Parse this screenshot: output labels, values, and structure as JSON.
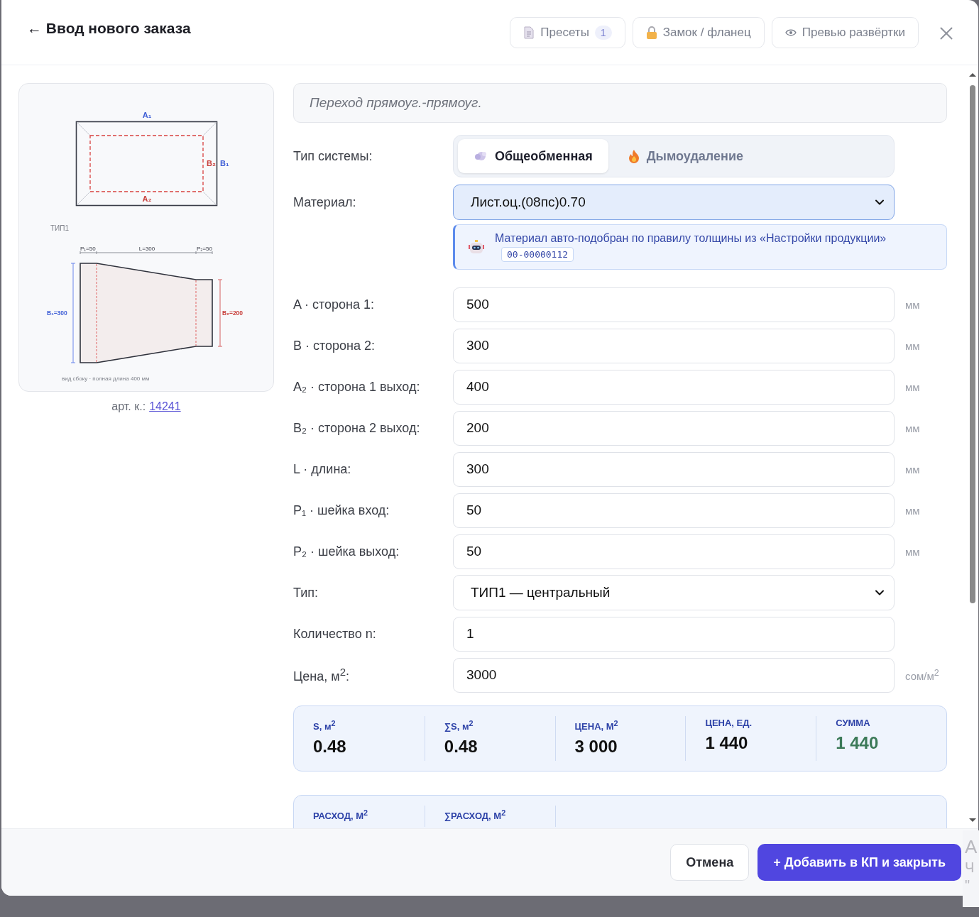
{
  "header": {
    "title": "← Ввод нового заказа",
    "buttons": [
      {
        "kind": "presets",
        "label": "Пресеты",
        "badge": "1"
      },
      {
        "kind": "lock",
        "label": "Замок / фланец"
      },
      {
        "kind": "eye",
        "label": "Превью развёртки"
      }
    ]
  },
  "diagram": {
    "top_labels": [
      "A₁",
      "B₂",
      "B₁",
      "A₂"
    ],
    "type_label": "ТИП1",
    "side_labels": [
      "P₁=50",
      "L=300",
      "P₂=50",
      "B₁=300",
      "B₂=200"
    ],
    "caption": "вид сбоку · полная длина 400 мм"
  },
  "article": {
    "label": "арт. к.:",
    "link": "14241"
  },
  "product_name": "Переход прямоуг.-прямоуг.",
  "system_type": {
    "label": "Тип системы:",
    "options": [
      {
        "kind": "air",
        "label": "Общеобменная",
        "selected": true
      },
      {
        "kind": "fire",
        "label": "Дымоудаление",
        "selected": false
      }
    ]
  },
  "material": {
    "label": "Материал:",
    "value": "Лист.оц.(08пс)0.70",
    "focused": true
  },
  "notice": {
    "text": "Материал авто-подобран по правилу толщины из «Настройки продукции»",
    "code": "00-00000112"
  },
  "fields": [
    {
      "kind": "input",
      "label": "A · сторона 1:",
      "value": "500",
      "unit": "мм"
    },
    {
      "kind": "input",
      "label": "B · сторона 2:",
      "value": "300",
      "unit": "мм"
    },
    {
      "kind": "input",
      "label": "A₂ · сторона 1 выход:",
      "value": "400",
      "unit": "мм"
    },
    {
      "kind": "input",
      "label": "B₂ · сторона 2 выход:",
      "value": "200",
      "unit": "мм"
    },
    {
      "kind": "input",
      "label": "L · длина:",
      "value": "300",
      "unit": "мм"
    },
    {
      "kind": "input",
      "label": "P₁ · шейка вход:",
      "value": "50",
      "unit": "мм"
    },
    {
      "kind": "input",
      "label": "P₂ · шейка выход:",
      "value": "50",
      "unit": "мм"
    },
    {
      "kind": "select",
      "label": "Тип:",
      "value": "ТИП1 — центральный"
    },
    {
      "kind": "input",
      "label": "Количество n:",
      "value": "1"
    },
    {
      "kind": "input",
      "label": "Цена, м$^{2}$:",
      "value": "3000",
      "unit": "сом/м$^{2}$"
    }
  ],
  "summary": [
    {
      "label": "S, м$^{2}$",
      "value": "0.48",
      "highlight": false
    },
    {
      "label": "∑S, м$^{2}$",
      "value": "0.48",
      "highlight": false
    },
    {
      "label": "ЦЕНА, М$^{2}$",
      "value": "3 000",
      "highlight": false
    },
    {
      "label": "ЦЕНА, ЕД.",
      "value": "1 440",
      "highlight": false
    },
    {
      "label": "СУММА",
      "value": "1 440",
      "highlight": true
    }
  ],
  "consumption": [
    {
      "label": "РАСХОД, М$^{2}$"
    },
    {
      "label": "∑РАСХОД, М$^{2}$"
    }
  ],
  "footer": {
    "cancel": "Отмена",
    "submit": "+ Добавить в КП и закрыть"
  },
  "backdrop_texts": [
    "A",
    "Ч",
    "\""
  ]
}
